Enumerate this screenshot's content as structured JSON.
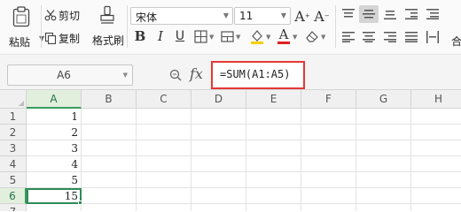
{
  "ribbon": {
    "paste_label": "粘贴",
    "cut_label": "剪切",
    "copy_label": "复制",
    "format_painter_label": "格式刷",
    "font_name": "宋体",
    "font_size": "11",
    "overflow_label": "合",
    "icons": {
      "paste": "clipboard-icon",
      "cut": "scissors-icon",
      "copy": "copy-icon",
      "format_painter": "paint-brush-icon",
      "bold": "B",
      "italic": "I",
      "underline": "U",
      "grow_font": "A⁺",
      "shrink_font": "A⁻",
      "font_color": "A"
    },
    "colors": {
      "fill_color": "#f5d100",
      "font_color": "#e02020"
    }
  },
  "formula_bar": {
    "name_box": "A6",
    "formula": "=SUM(A1:A5)",
    "fx_label": "fx",
    "highlight_color": "#e53935"
  },
  "grid": {
    "columns": [
      "A",
      "B",
      "C",
      "D",
      "E",
      "F",
      "G",
      "H"
    ],
    "rows": [
      "1",
      "2",
      "3",
      "4",
      "5",
      "6",
      "7"
    ],
    "cells_a": [
      "1",
      "2",
      "3",
      "4",
      "5",
      "15",
      ""
    ],
    "active_cell": "A6",
    "accent_color": "#2e8b57"
  }
}
